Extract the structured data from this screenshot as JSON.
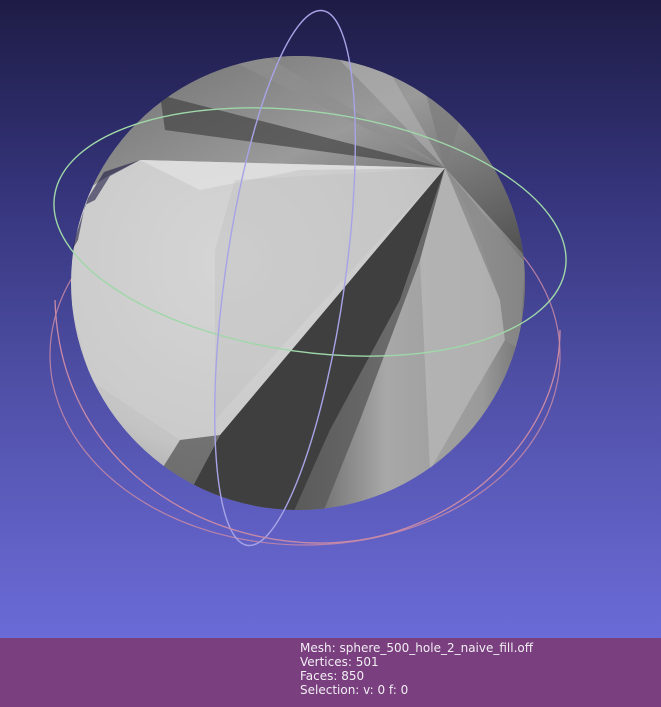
{
  "info": {
    "mesh_label": "Mesh:",
    "mesh_name": "sphere_500_hole_2_naive_fill.off",
    "vertices_label": "Vertices:",
    "vertices": "501",
    "faces_label": "Faces:",
    "faces": "850",
    "selection_label": "Selection:",
    "selection": "v: 0 f: 0"
  },
  "colors": {
    "bg_top": "#1e1c45",
    "bg_bottom": "#6b6bd8",
    "info_bar": "#7a3f7e",
    "ring_green": "#9fd7a8",
    "ring_blue": "#a7a3e6",
    "ring_red": "#c98aa6"
  },
  "icons": [
    "trackball-green-ring",
    "trackball-blue-ring",
    "trackball-red-ring"
  ]
}
